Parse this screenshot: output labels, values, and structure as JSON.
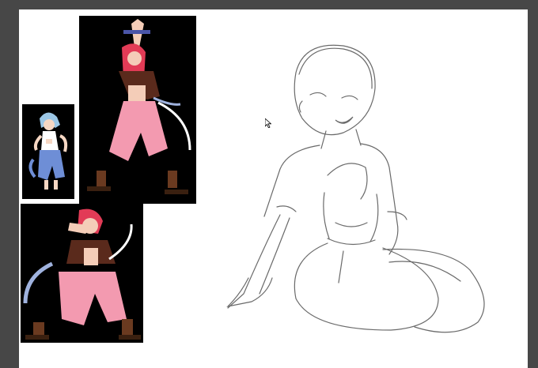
{
  "app": {
    "name": "Drawing canvas",
    "background": "#474747"
  },
  "canvas": {
    "background": "#ffffff",
    "items": [
      {
        "name": "reference-image-blue-hair",
        "kind": "image"
      },
      {
        "name": "reference-image-red-hair-arms-up",
        "kind": "image"
      },
      {
        "name": "reference-image-red-hair-stance",
        "kind": "image"
      },
      {
        "name": "pencil-sketch-figure",
        "kind": "drawing"
      }
    ]
  },
  "cursor": {
    "icon": "arrow-cursor-icon"
  }
}
